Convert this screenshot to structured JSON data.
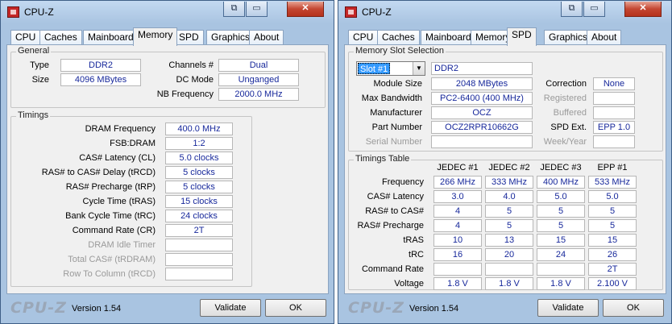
{
  "left_window": {
    "title": "CPU-Z",
    "titlebar_buttons": [
      "⧉",
      "▭",
      "✕"
    ],
    "tabs": [
      "CPU",
      "Caches",
      "Mainboard",
      "Memory",
      "SPD",
      "Graphics",
      "About"
    ],
    "active_tab": "Memory",
    "general": {
      "title": "General",
      "type_label": "Type",
      "type_value": "DDR2",
      "size_label": "Size",
      "size_value": "4096 MBytes",
      "channels_label": "Channels #",
      "channels_value": "Dual",
      "dcmode_label": "DC Mode",
      "dcmode_value": "Unganged",
      "nbfreq_label": "NB Frequency",
      "nbfreq_value": "2000.0 MHz"
    },
    "timings": {
      "title": "Timings",
      "rows": [
        {
          "label": "DRAM Frequency",
          "value": "400.0 MHz"
        },
        {
          "label": "FSB:DRAM",
          "value": "1:2"
        },
        {
          "label": "CAS# Latency (CL)",
          "value": "5.0 clocks"
        },
        {
          "label": "RAS# to CAS# Delay (tRCD)",
          "value": "5 clocks"
        },
        {
          "label": "RAS# Precharge (tRP)",
          "value": "5 clocks"
        },
        {
          "label": "Cycle Time (tRAS)",
          "value": "15 clocks"
        },
        {
          "label": "Bank Cycle Time (tRC)",
          "value": "24 clocks"
        },
        {
          "label": "Command Rate (CR)",
          "value": "2T"
        },
        {
          "label": "DRAM Idle Timer",
          "value": ""
        },
        {
          "label": "Total CAS# (tRDRAM)",
          "value": ""
        },
        {
          "label": "Row To Column (tRCD)",
          "value": ""
        }
      ]
    },
    "footer": {
      "logo": "CPU-Z",
      "version": "Version 1.54",
      "validate": "Validate",
      "ok": "OK"
    }
  },
  "right_window": {
    "title": "CPU-Z",
    "titlebar_buttons": [
      "⧉",
      "▭",
      "✕"
    ],
    "tabs": [
      "CPU",
      "Caches",
      "Mainboard",
      "Memory",
      "SPD",
      "Graphics",
      "About"
    ],
    "active_tab": "SPD",
    "slot_section": {
      "title": "Memory Slot Selection",
      "selected_slot": "Slot #1",
      "memory_type": "DDR2",
      "module_size_label": "Module Size",
      "module_size": "2048 MBytes",
      "max_bandwidth_label": "Max Bandwidth",
      "max_bandwidth": "PC2-6400 (400 MHz)",
      "manufacturer_label": "Manufacturer",
      "manufacturer": "OCZ",
      "part_number_label": "Part Number",
      "part_number": "OCZ2RPR10662G",
      "serial_number_label": "Serial Number",
      "serial_number": "",
      "correction_label": "Correction",
      "correction": "None",
      "registered_label": "Registered",
      "registered": "",
      "buffered_label": "Buffered",
      "buffered": "",
      "spd_ext_label": "SPD Ext.",
      "spd_ext": "EPP 1.0",
      "week_year_label": "Week/Year",
      "week_year": ""
    },
    "timings_table": {
      "title": "Timings Table",
      "columns": [
        "JEDEC #1",
        "JEDEC #2",
        "JEDEC #3",
        "EPP #1"
      ],
      "rows": [
        {
          "label": "Frequency",
          "values": [
            "266 MHz",
            "333 MHz",
            "400 MHz",
            "533 MHz"
          ]
        },
        {
          "label": "CAS# Latency",
          "values": [
            "3.0",
            "4.0",
            "5.0",
            "5.0"
          ]
        },
        {
          "label": "RAS# to CAS#",
          "values": [
            "4",
            "5",
            "5",
            "5"
          ]
        },
        {
          "label": "RAS# Precharge",
          "values": [
            "4",
            "5",
            "5",
            "5"
          ]
        },
        {
          "label": "tRAS",
          "values": [
            "10",
            "13",
            "15",
            "15"
          ]
        },
        {
          "label": "tRC",
          "values": [
            "16",
            "20",
            "24",
            "26"
          ]
        },
        {
          "label": "Command Rate",
          "values": [
            "",
            "",
            "",
            "2T"
          ]
        },
        {
          "label": "Voltage",
          "values": [
            "1.8 V",
            "1.8 V",
            "1.8 V",
            "2.100 V"
          ]
        }
      ]
    },
    "footer": {
      "logo": "CPU-Z",
      "version": "Version 1.54",
      "validate": "Validate",
      "ok": "OK"
    }
  }
}
